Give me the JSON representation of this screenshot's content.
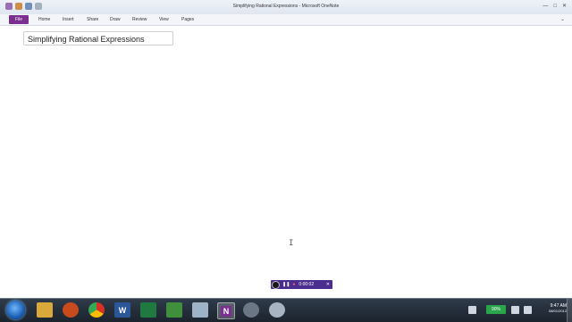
{
  "window": {
    "title": "Simplifying Rational Expressions - Microsoft OneNote",
    "controls": {
      "minimize": "—",
      "maximize": "□",
      "close": "✕"
    }
  },
  "ribbon": {
    "file_tab": "File",
    "tabs": [
      "Home",
      "Insert",
      "Share",
      "Draw",
      "Review",
      "View",
      "Pages"
    ]
  },
  "page": {
    "title": "Simplifying Rational Expressions"
  },
  "recorder": {
    "time": "0:00:02"
  },
  "taskbar": {
    "apps": [
      {
        "name": "folder-icon"
      },
      {
        "name": "media-player-icon"
      },
      {
        "name": "chrome-icon"
      },
      {
        "name": "word-icon",
        "label": "W"
      },
      {
        "name": "excel-icon"
      },
      {
        "name": "calculator-icon"
      },
      {
        "name": "notepad-icon"
      },
      {
        "name": "onenote-icon",
        "label": "N"
      },
      {
        "name": "settings-icon"
      },
      {
        "name": "tool-icon"
      }
    ],
    "battery": "90%",
    "clock": {
      "time": "9:47 AM",
      "date": "08/01/2012"
    }
  },
  "colors": {
    "onenote_purple": "#7b2f8e",
    "recorder_bg": "#4b2d8f",
    "taskbar": "#1b232d"
  }
}
